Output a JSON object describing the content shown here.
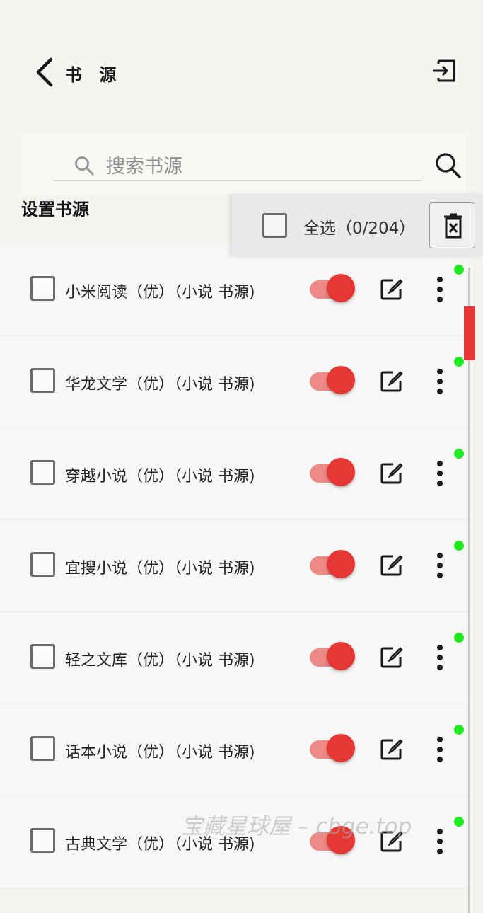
{
  "header": {
    "title": "书 源"
  },
  "search": {
    "placeholder": "搜索书源"
  },
  "section": {
    "title": "设置书源"
  },
  "toolbar": {
    "select_all_label": "全选（0/204）"
  },
  "sources": [
    {
      "name": "小米阅读（优）（小说 书源)",
      "enabled": true
    },
    {
      "name": "华龙文学（优）（小说 书源)",
      "enabled": true
    },
    {
      "name": "穿越小说（优）（小说 书源)",
      "enabled": true
    },
    {
      "name": "宜搜小说（优）（小说 书源)",
      "enabled": true
    },
    {
      "name": "轻之文库（优）（小说 书源)",
      "enabled": true
    },
    {
      "name": "话本小说（优）（小说 书源)",
      "enabled": true
    },
    {
      "name": "古典文学（优）（小说 书源)",
      "enabled": true
    }
  ],
  "watermark": "宝藏星球屋 – cbge.top",
  "colors": {
    "accent": "#e53835",
    "toggle_track": "#ee8a86",
    "status_dot": "#1fea1f"
  },
  "icons": {
    "back": "chevron-left-icon",
    "import": "import-icon",
    "search": "search-icon",
    "delete": "delete-icon",
    "edit": "edit-icon",
    "more": "more-vertical-icon"
  }
}
